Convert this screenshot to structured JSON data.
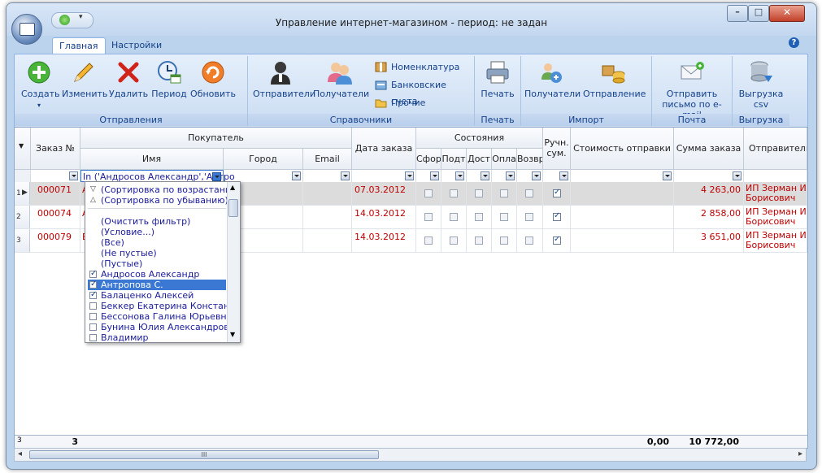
{
  "window": {
    "title": "Управление интернет-магазином - период: не задан",
    "minimize": "–",
    "maximize": "□",
    "close": "✕"
  },
  "qat": {
    "dropdown": "▾"
  },
  "tabs": [
    {
      "label": "Главная"
    },
    {
      "label": "Настройки"
    }
  ],
  "help": "?",
  "ribbon": {
    "groups": [
      {
        "label": "Отправления",
        "buttons": [
          {
            "label": "Создать",
            "icon": "add-icon"
          },
          {
            "label": "Изменить",
            "icon": "pencil-icon"
          },
          {
            "label": "Удалить",
            "icon": "delete-icon"
          },
          {
            "label": "Период",
            "icon": "calendar-icon"
          },
          {
            "label": "Обновить",
            "icon": "refresh-icon"
          }
        ]
      },
      {
        "label": "Справочники",
        "buttons": [
          {
            "label": "Отправители",
            "icon": "person-icon"
          },
          {
            "label": "Получатели",
            "icon": "people-icon"
          },
          {
            "label": "Номенклатура",
            "icon": "box-icon"
          },
          {
            "label": "Банковские счета",
            "icon": "bank-icon"
          },
          {
            "label": "Прочие",
            "icon": "folder-icon"
          }
        ]
      },
      {
        "label": "Печать",
        "buttons": [
          {
            "label": "Печать",
            "icon": "printer-icon"
          }
        ]
      },
      {
        "label": "Импорт",
        "buttons": [
          {
            "label": "Получатели",
            "icon": "import-people-icon"
          },
          {
            "label": "Отправление",
            "icon": "import-parcel-icon"
          }
        ]
      },
      {
        "label": "Почта",
        "buttons": [
          {
            "label": "Отправить письмо по e-mail",
            "icon": "email-icon"
          }
        ]
      },
      {
        "label": "Выгрузка",
        "buttons": [
          {
            "label": "Выгрузка csv",
            "icon": "database-export-icon"
          }
        ]
      }
    ]
  },
  "grid": {
    "headers": {
      "order": "Заказ №",
      "buyer": "Покупатель",
      "name": "Имя",
      "city": "Город",
      "email": "Email",
      "date": "Дата заказа",
      "states": "Состояния",
      "st1": "Сфор",
      "st2": "Подт",
      "st3": "Дост",
      "st4": "Опла",
      "st5": "Возвр",
      "manual": "Ручн. сум.",
      "shipping": "Стоимость отправки",
      "sum": "Сумма заказа",
      "sender": "Отправитель"
    },
    "name_filter": "In ('Андросов Александр','Антро",
    "rows": [
      {
        "num": "1",
        "order": "000071",
        "name_initial": "А",
        "date": "07.03.2012",
        "checks": [
          false,
          false,
          false,
          false,
          false
        ],
        "manual": true,
        "sum": "4 263,00",
        "sender1": "ИП Зерман Игор",
        "sender2": "Борисович"
      },
      {
        "num": "2",
        "order": "000074",
        "name_initial": "А",
        "date": "14.03.2012",
        "checks": [
          false,
          false,
          false,
          false,
          false
        ],
        "manual": true,
        "sum": "2 858,00",
        "sender1": "ИП Зерман Игор",
        "sender2": "Борисович"
      },
      {
        "num": "3",
        "order": "000079",
        "name_initial": "Б",
        "date": "14.03.2012",
        "checks": [
          false,
          false,
          false,
          false,
          false
        ],
        "manual": true,
        "sum": "3 651,00",
        "sender1": "ИП Зерман Игор",
        "sender2": "Борисович"
      }
    ],
    "footer": {
      "row_count": "3",
      "order_count": "3",
      "shipping_total": "0,00",
      "sum_total": "10 772,00"
    }
  },
  "filter_popup": {
    "sort_asc": "(Сортировка по возрастанию)",
    "sort_desc": "(Сортировка по убыванию)",
    "items": [
      {
        "label": "(Очистить фильтр)",
        "checkbox": false
      },
      {
        "label": "(Условие...)",
        "checkbox": false
      },
      {
        "label": "(Все)",
        "checkbox": false
      },
      {
        "label": "(Не пустые)",
        "checkbox": false
      },
      {
        "label": "(Пустые)",
        "checkbox": false
      },
      {
        "label": "Андросов Александр",
        "checkbox": true,
        "checked": true
      },
      {
        "label": "Антропова С.",
        "checkbox": true,
        "checked": true,
        "selected": true
      },
      {
        "label": "Балаценко Алексей",
        "checkbox": true,
        "checked": true
      },
      {
        "label": "Беккер Екатерина Константин",
        "checkbox": true,
        "checked": false
      },
      {
        "label": "Бессонова Галина Юрьевна",
        "checkbox": true,
        "checked": false
      },
      {
        "label": "Бунина Юлия Александровна",
        "checkbox": true,
        "checked": false
      },
      {
        "label": "Владимир",
        "checkbox": true,
        "checked": false
      }
    ]
  },
  "hscroll": {
    "grip": "III",
    "left": "◂",
    "right": "▸"
  }
}
